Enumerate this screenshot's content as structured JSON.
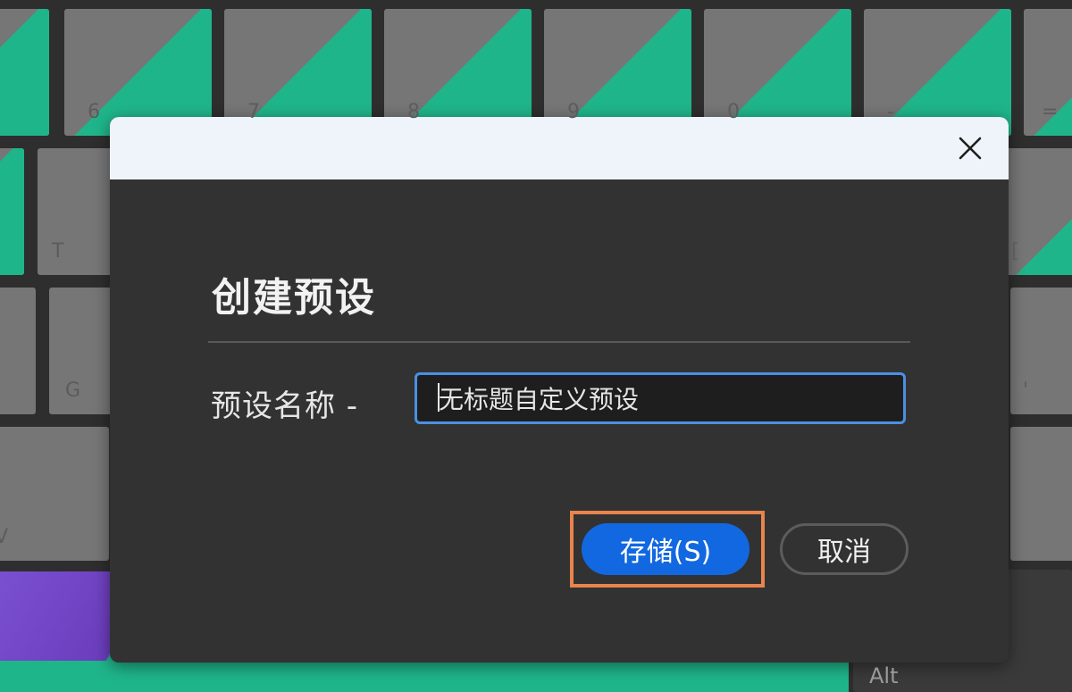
{
  "dialog": {
    "title": "创建预设",
    "field_label": "预设名称 -",
    "input_value": "无标题自定义预设",
    "save_label": "存储(S)",
    "cancel_label": "取消",
    "close_icon": "close-icon"
  },
  "keyboard": {
    "visible_key_labels": [
      "6",
      "7",
      "8",
      "9",
      "0",
      "-",
      "=",
      "T",
      "[",
      "G",
      "'",
      "V",
      "Alt"
    ]
  },
  "colors": {
    "accent_green": "#1fb58a",
    "primary_blue": "#1268e0",
    "highlight_orange": "#e8844c",
    "input_focus_border": "#4a90e2",
    "dialog_background": "#323232",
    "titlebar_background": "#eef4f9"
  }
}
